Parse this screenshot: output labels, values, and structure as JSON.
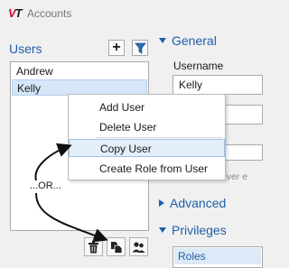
{
  "titlebar": {
    "logo_v": "V",
    "logo_t": "T",
    "title": "Accounts"
  },
  "users_panel": {
    "title": "Users",
    "add_label": "+",
    "users": [
      "Andrew",
      "Kelly"
    ],
    "selected_user": "Kelly"
  },
  "context_menu": {
    "items": [
      "Add User",
      "Delete User",
      "Copy User",
      "Create Role from User"
    ],
    "highlighted": "Copy User"
  },
  "annotation": {
    "or_label": "...OR..."
  },
  "general": {
    "heading": "General",
    "username_label": "Username",
    "username_value": "Kelly",
    "password_note": "Password never e"
  },
  "advanced": {
    "heading": "Advanced"
  },
  "privileges": {
    "heading": "Privileges",
    "roles_item": "Roles"
  },
  "colors": {
    "accent": "#1f5fa8",
    "logo_red": "#c8102e",
    "selection": "#d5e6f8"
  }
}
